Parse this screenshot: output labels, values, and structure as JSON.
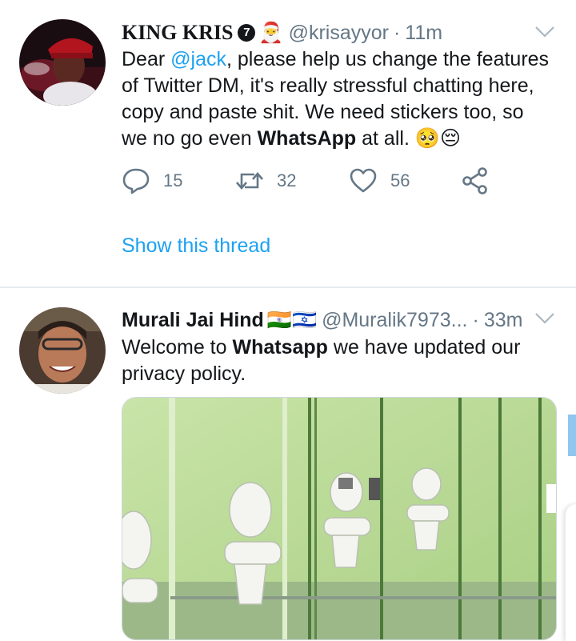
{
  "tweets": [
    {
      "author": {
        "name": "KING KRIS",
        "badge": "7",
        "emoji": "🎅",
        "handle": "@krisayyor",
        "time": "11m"
      },
      "text": {
        "part1": "Dear ",
        "mention": "@jack",
        "part2": ", please help us change the features of Twitter DM, it's really stressful chatting here, copy and paste shit. We need stickers too, so we no go even ",
        "bold": "WhatsApp",
        "part3": " at all. 🥺😔"
      },
      "actions": {
        "replies": "15",
        "retweets": "32",
        "likes": "56"
      },
      "show_thread": "Show this thread"
    },
    {
      "author": {
        "name": "Murali Jai Hind",
        "flags": "🇮🇳🇮🇱",
        "handle": "@Muralik7973...",
        "time": "33m"
      },
      "text": {
        "part1": "Welcome to ",
        "bold": "Whatsapp",
        "part2": " we have updated our privacy policy."
      }
    }
  ],
  "separator": "·",
  "icons": {
    "reply": "reply-icon",
    "retweet": "retweet-icon",
    "like": "heart-icon",
    "share": "share-icon",
    "menu": "chevron-down-icon"
  },
  "colors": {
    "accent": "#1da1f2",
    "secondary_text": "#657786",
    "divider": "#e6ecf0"
  }
}
